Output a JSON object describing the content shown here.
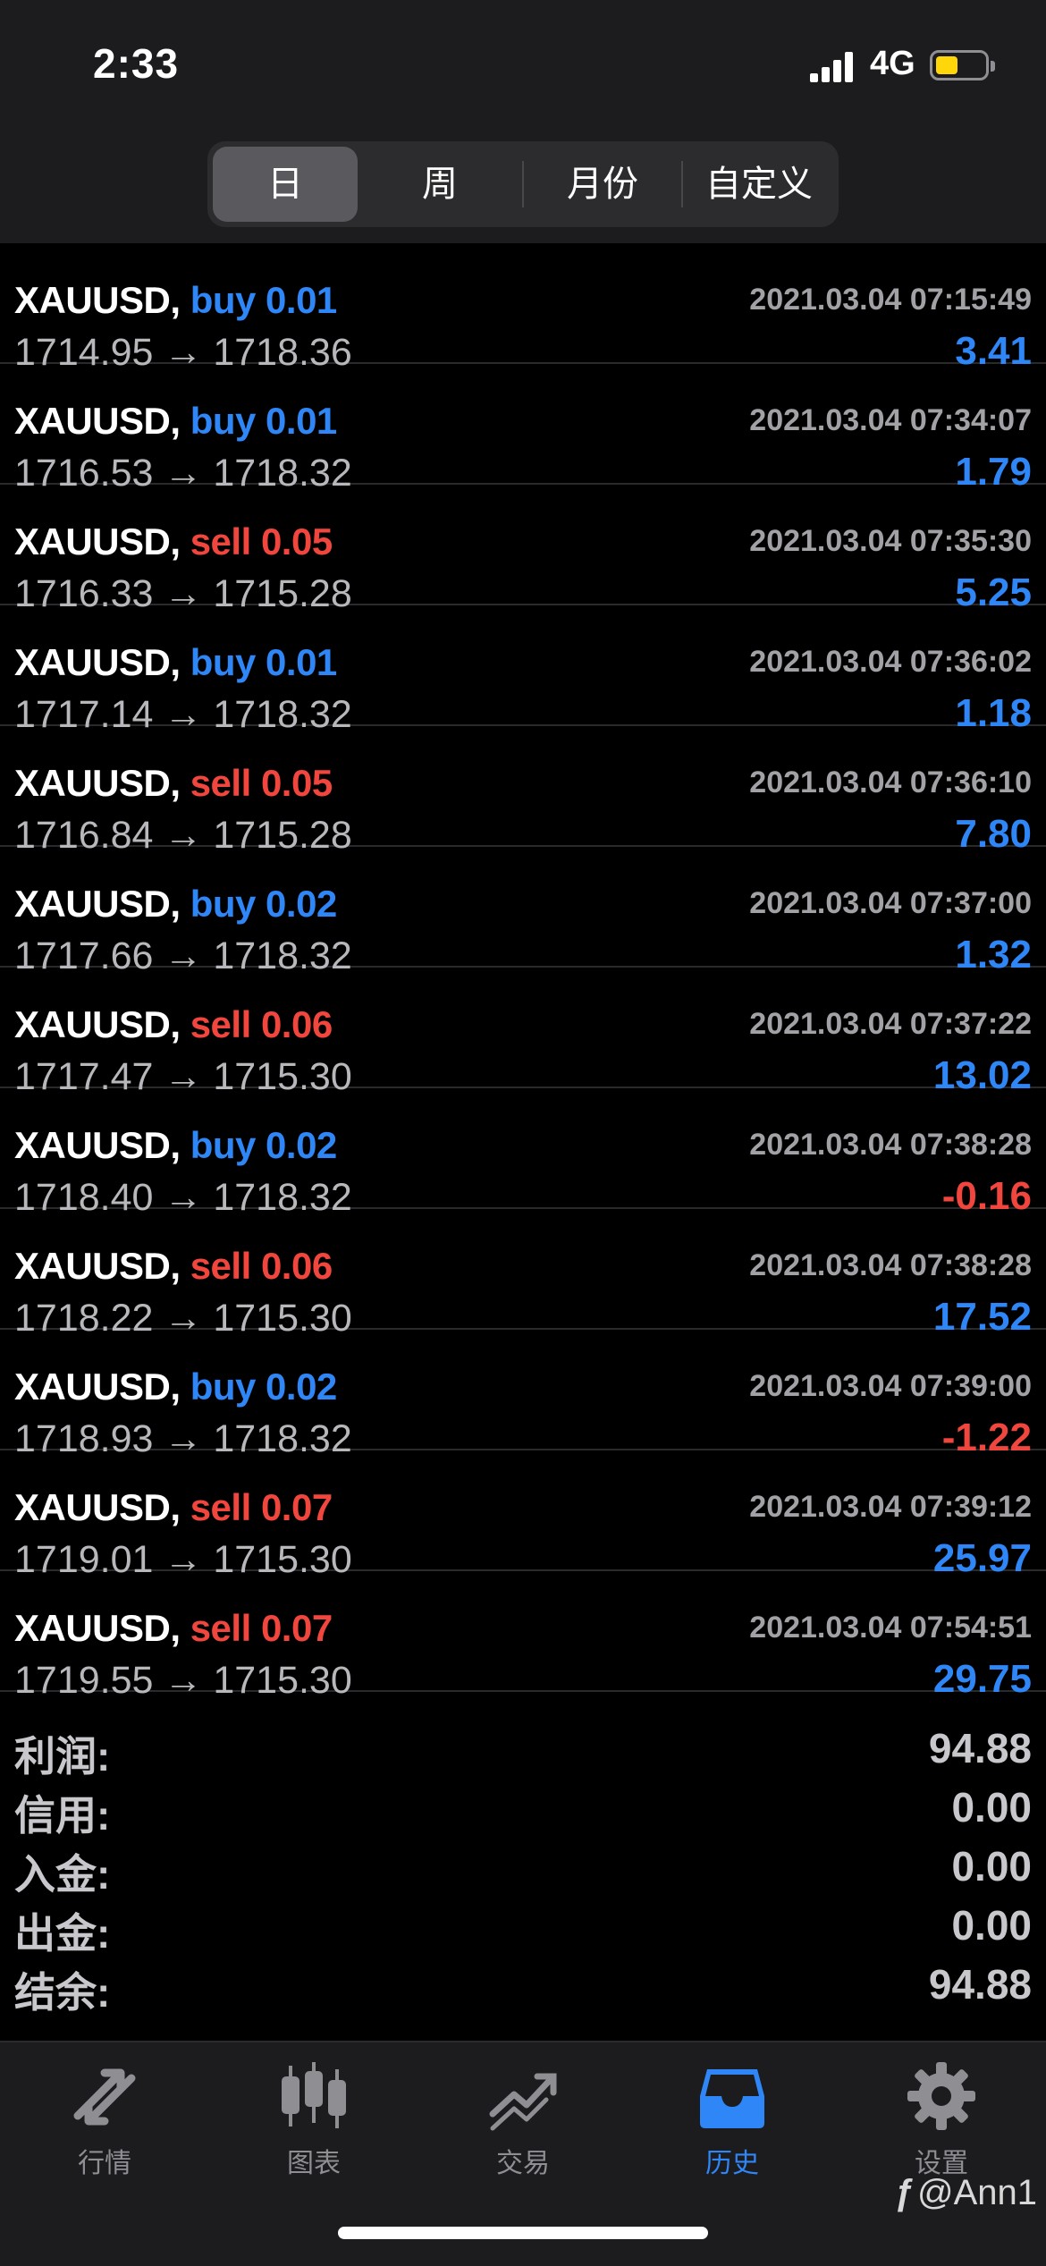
{
  "status_bar": {
    "time": "2:33",
    "network": "4G"
  },
  "segments": [
    "日",
    "周",
    "月份",
    "自定义"
  ],
  "deals": [
    {
      "symbol": "XAUUSD,",
      "side": "buy",
      "volume": "0.01",
      "time": "2021.03.04 07:15:49",
      "prices": "1714.95 → 1718.36",
      "profit": "3.41",
      "profit_sign": "pos"
    },
    {
      "symbol": "XAUUSD,",
      "side": "buy",
      "volume": "0.01",
      "time": "2021.03.04 07:34:07",
      "prices": "1716.53 → 1718.32",
      "profit": "1.79",
      "profit_sign": "pos"
    },
    {
      "symbol": "XAUUSD,",
      "side": "sell",
      "volume": "0.05",
      "time": "2021.03.04 07:35:30",
      "prices": "1716.33 → 1715.28",
      "profit": "5.25",
      "profit_sign": "pos"
    },
    {
      "symbol": "XAUUSD,",
      "side": "buy",
      "volume": "0.01",
      "time": "2021.03.04 07:36:02",
      "prices": "1717.14 → 1718.32",
      "profit": "1.18",
      "profit_sign": "pos"
    },
    {
      "symbol": "XAUUSD,",
      "side": "sell",
      "volume": "0.05",
      "time": "2021.03.04 07:36:10",
      "prices": "1716.84 → 1715.28",
      "profit": "7.80",
      "profit_sign": "pos"
    },
    {
      "symbol": "XAUUSD,",
      "side": "buy",
      "volume": "0.02",
      "time": "2021.03.04 07:37:00",
      "prices": "1717.66 → 1718.32",
      "profit": "1.32",
      "profit_sign": "pos"
    },
    {
      "symbol": "XAUUSD,",
      "side": "sell",
      "volume": "0.06",
      "time": "2021.03.04 07:37:22",
      "prices": "1717.47 → 1715.30",
      "profit": "13.02",
      "profit_sign": "pos"
    },
    {
      "symbol": "XAUUSD,",
      "side": "buy",
      "volume": "0.02",
      "time": "2021.03.04 07:38:28",
      "prices": "1718.40 → 1718.32",
      "profit": "-0.16",
      "profit_sign": "neg"
    },
    {
      "symbol": "XAUUSD,",
      "side": "sell",
      "volume": "0.06",
      "time": "2021.03.04 07:38:28",
      "prices": "1718.22 → 1715.30",
      "profit": "17.52",
      "profit_sign": "pos"
    },
    {
      "symbol": "XAUUSD,",
      "side": "buy",
      "volume": "0.02",
      "time": "2021.03.04 07:39:00",
      "prices": "1718.93 → 1718.32",
      "profit": "-1.22",
      "profit_sign": "neg"
    },
    {
      "symbol": "XAUUSD,",
      "side": "sell",
      "volume": "0.07",
      "time": "2021.03.04 07:39:12",
      "prices": "1719.01 → 1715.30",
      "profit": "25.97",
      "profit_sign": "pos"
    },
    {
      "symbol": "XAUUSD,",
      "side": "sell",
      "volume": "0.07",
      "time": "2021.03.04 07:54:51",
      "prices": "1719.55 → 1715.30",
      "profit": "29.75",
      "profit_sign": "pos"
    }
  ],
  "summary": [
    {
      "label": "利润:",
      "value": "94.88"
    },
    {
      "label": "信用:",
      "value": "0.00"
    },
    {
      "label": "入金:",
      "value": "0.00"
    },
    {
      "label": "出金:",
      "value": "0.00"
    },
    {
      "label": "结余:",
      "value": "94.88"
    }
  ],
  "tabs": [
    {
      "label": "行情",
      "icon": "quotes-icon",
      "active": false
    },
    {
      "label": "图表",
      "icon": "chart-candles-icon",
      "active": false
    },
    {
      "label": "交易",
      "icon": "trade-icon",
      "active": false
    },
    {
      "label": "历史",
      "icon": "history-inbox-icon",
      "active": true
    },
    {
      "label": "设置",
      "icon": "gear-icon",
      "active": false
    }
  ],
  "watermark": "@Ann1",
  "colors": {
    "buy": "#2f86f6",
    "sell": "#f0463e",
    "active_tab": "#2f86f6",
    "battery": "#ffd60a"
  }
}
